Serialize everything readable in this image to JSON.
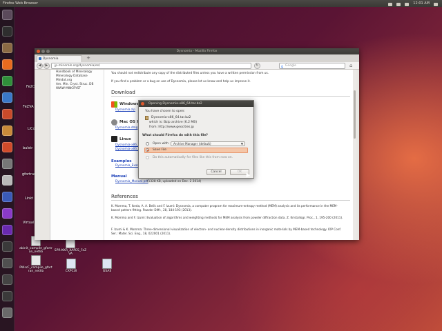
{
  "top_panel": {
    "app_title": "Firefox Web Browser",
    "clock": "12:01 AM"
  },
  "launcher": {
    "icons": [
      {
        "name": "dash-icon",
        "color": "#5b4a5b"
      },
      {
        "name": "terminal-icon",
        "color": "#2e2e2e"
      },
      {
        "name": "files-icon",
        "color": "#8a6a44"
      },
      {
        "name": "firefox-icon",
        "color": "#e86b1f"
      },
      {
        "name": "calc-icon",
        "color": "#2f8f3a"
      },
      {
        "name": "writer-icon",
        "color": "#3a78c8"
      },
      {
        "name": "impress-icon",
        "color": "#c84a2a"
      },
      {
        "name": "software-center-icon",
        "color": "#c88a3a"
      },
      {
        "name": "ubuntu-one-icon",
        "color": "#d04a2a"
      },
      {
        "name": "settings-icon",
        "color": "#777777"
      },
      {
        "name": "text-editor-icon",
        "color": "#b8b8b8"
      },
      {
        "name": "virtualbox-icon",
        "color": "#3a5ab8"
      },
      {
        "name": "app-icon-purple",
        "color": "#8a3ac8"
      },
      {
        "name": "app-icon-purple-2",
        "color": "#6a2ab0"
      },
      {
        "name": "app-icon-dark",
        "color": "#3a3a3a"
      },
      {
        "name": "app-icon-dark-2",
        "color": "#505050"
      },
      {
        "name": "app-icon-dark-3",
        "color": "#444444"
      },
      {
        "name": "app-icon-dark-4",
        "color": "#3a3a3a"
      },
      {
        "name": "trash-icon",
        "color": "#6a6a6a"
      }
    ]
  },
  "desktop": {
    "side_labels": [
      "Fe2O",
      "FeZVA",
      "LiCo",
      "bulstr",
      "gfortran",
      "Linkt",
      "Virtual"
    ],
    "icons": [
      {
        "label": "abinit_compile_gfortran_netlib"
      },
      {
        "label": "SPR-KKR_XAPES_FeZVA"
      },
      {
        "label": "PWscF_compile_gfortran_netlib"
      },
      {
        "label": "CXPCUI"
      },
      {
        "label": "GSAS"
      }
    ]
  },
  "browser": {
    "window_title": "Dysnomia - Mozilla Firefox",
    "tab_label": "Dysnomia",
    "url": "jp-minerals.org/dysnomia/en/",
    "search_placeholder": "Google",
    "left_panel": [
      "Handbook of Mineralogy",
      "Mineralogy Database",
      "Mindat.org",
      "Am. Min. Cryst. Struc. DB",
      "WWW-MINCRYST"
    ],
    "page": {
      "top_lines": [
        "You should not redistribute any copy of the distributed files unless you have a written permission from us.",
        "If you find a problem or a bug on use of Dysnomia, please let us know and help us improve it."
      ],
      "download_heading": "Download",
      "os": [
        {
          "name": "Windows",
          "link": "Dysnomia.zip"
        },
        {
          "name": "Mac OS X",
          "link": "Dysnomia.dmg"
        },
        {
          "name": "Linux",
          "link": "Dysnomia-x86_",
          "link2": "Dysnomia-x86_64"
        }
      ],
      "examples_title": "Examples",
      "examples_link": "Dysnomia_Exam",
      "manual_title": "Manual",
      "manual_link": "Dysnomia_Manual.pdf",
      "manual_note": "(1328 KB, uploaded on Dec. 2 2014)",
      "references_heading": "References",
      "references": [
        "K. Momma, T. Ikeda, A. A. Belik and F. Izumi: Dysnomia, a computer program for maximum-entropy method (MEM) analysis and its performance in the MEM-based pattern fitting. Powder Diffr., 28, 184-193 (2013).",
        "K. Momma and F. Izumi: Evaluation of algorithms and weighting methods for MEM analysis from powder diffraction data. Z. Kristallogr. Proc., 1, 195-200 (2011).",
        "F. Izumi & K. Momma: Three-dimensional visualization of electron- and nuclear-density distributions in inorganic materials by MEM-based technology. IOP Conf. Ser.: Mater. Sci. Eng., 18, 022001 (2011)."
      ]
    }
  },
  "dialog": {
    "title": "Opening Dysnomia-x86_64.tar.bz2",
    "intro": "You have chosen to open:",
    "filename": "Dysnomia-x86_64.tar.bz2",
    "which_is": "which is: Bzip archive (6.2 MB)",
    "from": "from: http://www.geocities.jp",
    "question": "What should Firefox do with this file?",
    "open_with_label": "Open with",
    "open_with_value": "Archive Manager (default)",
    "save_file_label": "Save File",
    "auto_label": "Do this automatically for files like this from now on.",
    "cancel_label": "Cancel",
    "ok_label": "OK",
    "selected_option": "save_file"
  }
}
